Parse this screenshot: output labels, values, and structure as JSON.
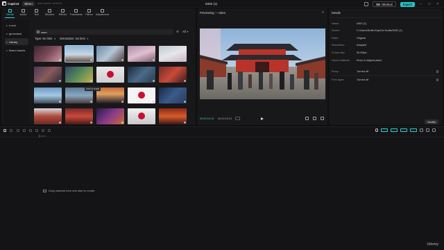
{
  "app": {
    "name": "CapCut",
    "menu_label": "Menu",
    "auto_saved": "Auto saved: 14:05:41",
    "project_title": "0402 (1)",
    "shortcut_label": "Shortcut",
    "export_label": "Export",
    "accent_color": "#21c5c7"
  },
  "toolbar": {
    "tabs": [
      {
        "label": "Media",
        "icon": "media-icon",
        "active": true
      },
      {
        "label": "Audio",
        "icon": "audio-icon"
      },
      {
        "label": "Text",
        "icon": "text-icon"
      },
      {
        "label": "Stickers",
        "icon": "stickers-icon"
      },
      {
        "label": "Effects",
        "icon": "effects-icon"
      },
      {
        "label": "Transitions",
        "icon": "transitions-icon"
      },
      {
        "label": "Filters",
        "icon": "filters-icon"
      },
      {
        "label": "Adjustment",
        "icon": "adjustment-icon"
      }
    ]
  },
  "library": {
    "side_items": [
      {
        "label": "Local",
        "active": false
      },
      {
        "label": "generated",
        "active": false
      },
      {
        "label": "Library",
        "active": true
      },
      {
        "label": "Brand assets",
        "active": false
      }
    ],
    "search_value": "asan",
    "all_label": "All",
    "filter_type": "Type: No limit",
    "filter_orientation": "Orientation: No limit",
    "tooltip": "Add to track"
  },
  "player": {
    "title": "Previewing — video",
    "current_time": "00:00:16:15",
    "total_time": "00:00:16:24"
  },
  "details": {
    "title": "Details",
    "rows": [
      {
        "label": "Name:",
        "value": "0402 (1)"
      },
      {
        "label": "Saved:",
        "value": "C:/Users/Smith/CapCut Drafts/0402 (1)"
      },
      {
        "label": "Ratio:",
        "value": "Original"
      },
      {
        "label": "Resolution:",
        "value": "Adapted"
      },
      {
        "label": "Frame rate:",
        "value": "30.00fps"
      },
      {
        "label": "Import material:",
        "value": "Keep in original place"
      },
      {
        "label": "Proxy:",
        "value": "Turned off"
      },
      {
        "label": "Free layer:",
        "value": "Turned off"
      }
    ],
    "modify_label": "Modify"
  },
  "timeline": {
    "ruler_label": "00:00",
    "drop_text": "Drag material here and start to create"
  },
  "watermark": "Udemy"
}
